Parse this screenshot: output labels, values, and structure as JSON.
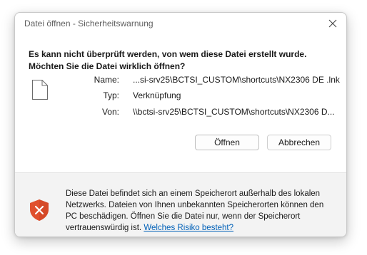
{
  "window": {
    "title": "Datei öffnen - Sicherheitswarnung"
  },
  "question": {
    "line1": "Es kann nicht überprüft werden, von wem diese Datei erstellt wurde.",
    "line2": "Möchten Sie die Datei wirklich öffnen?"
  },
  "file": {
    "icon": "document-icon",
    "name_label": "Name:",
    "name_value": "...si-srv25\\BCTSI_CUSTOM\\shortcuts\\NX2306 DE .lnk",
    "type_label": "Typ:",
    "type_value": "Verknüpfung",
    "from_label": "Von:",
    "from_value": "\\\\bctsi-srv25\\BCTSI_CUSTOM\\shortcuts\\NX2306 D..."
  },
  "buttons": {
    "open": "Öffnen",
    "cancel": "Abbrechen"
  },
  "warning": {
    "icon": "shield-warning-icon",
    "text": "Diese Datei befindet sich an einem Speicherort außerhalb des lokalen Netzwerks. Dateien von Ihnen unbekannten Speicherorten können den PC beschädigen. Öffnen Sie die Datei nur, wenn der Speicherort vertrauenswürdig ist.",
    "link": "Welches Risiko besteht?"
  },
  "colors": {
    "shield": "#e0502e",
    "link": "#0060b8"
  }
}
